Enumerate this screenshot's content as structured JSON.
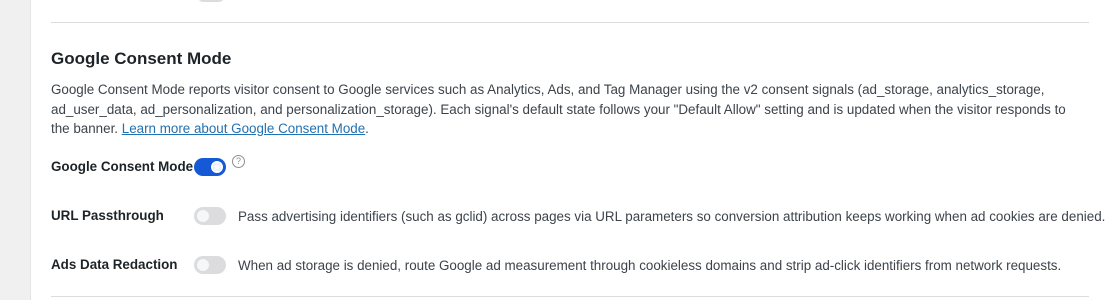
{
  "section": {
    "title": "Google Consent Mode",
    "description_text": "Google Consent Mode reports visitor consent to Google services such as Analytics, Ads, and Tag Manager using the v2 consent signals (ad_storage, analytics_storage, ad_user_data, ad_personalization, and personalization_storage). Each signal's default state follows your \"Default Allow\" setting and is updated when the visitor responds to the banner.",
    "learn_more_link": "Learn more about Google Consent Mode",
    "learn_more_suffix": "."
  },
  "settings": {
    "consent_mode": {
      "label": "Google Consent Mode",
      "enabled": true,
      "help_glyph": "?"
    },
    "url_passthrough": {
      "label": "URL Passthrough",
      "enabled": false,
      "description": "Pass advertising identifiers (such as gclid) across pages via URL parameters so conversion attribution keeps working when ad cookies are denied."
    },
    "ads_data_redaction": {
      "label": "Ads Data Redaction",
      "enabled": false,
      "description": "When ad storage is denied, route Google ad measurement through cookieless domains and strip ad-click identifiers from network requests."
    }
  },
  "colors": {
    "accent": "#1659d6",
    "link": "#2271b1",
    "toggle_off": "#dcdcde"
  }
}
